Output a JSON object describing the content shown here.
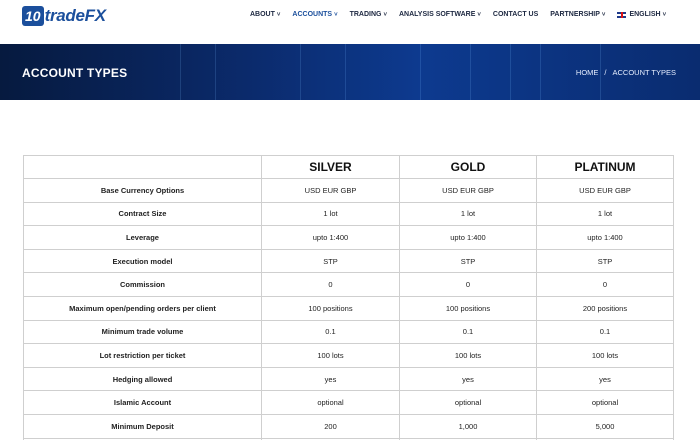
{
  "header": {
    "logo_badge": "10",
    "logo_text": "tradeFX",
    "nav": [
      {
        "label": "ABOUT",
        "chevron": true,
        "active": false
      },
      {
        "label": "ACCOUNTS",
        "chevron": true,
        "active": true
      },
      {
        "label": "TRADING",
        "chevron": true,
        "active": false
      },
      {
        "label": "ANALYSIS SOFTWARE",
        "chevron": true,
        "active": false
      },
      {
        "label": "CONTACT US",
        "chevron": false,
        "active": false
      },
      {
        "label": "PARTNERSHIP",
        "chevron": true,
        "active": false
      },
      {
        "label": "ENGLISH",
        "chevron": true,
        "active": false,
        "flag": "uk-flag-icon"
      }
    ]
  },
  "banner": {
    "title": "ACCOUNT TYPES",
    "breadcrumb": [
      "HOME",
      "/",
      "ACCOUNT TYPES"
    ]
  },
  "table": {
    "columns": [
      "",
      "SILVER",
      "GOLD",
      "PLATINUM"
    ],
    "rows": [
      {
        "label": "Base Currency Options",
        "values": [
          "USD EUR GBP",
          "USD EUR GBP",
          "USD EUR GBP"
        ]
      },
      {
        "label": "Contract Size",
        "values": [
          "1 lot",
          "1 lot",
          "1 lot"
        ]
      },
      {
        "label": "Leverage",
        "values": [
          "upto 1:400",
          "upto 1:400",
          "upto 1:400"
        ]
      },
      {
        "label": "Execution model",
        "values": [
          "STP",
          "STP",
          "STP"
        ]
      },
      {
        "label": "Commission",
        "values": [
          "0",
          "0",
          "0"
        ]
      },
      {
        "label": "Maximum open/pending orders per client",
        "values": [
          "100 positions",
          "100 positions",
          "200 positions"
        ]
      },
      {
        "label": "Minimum trade volume",
        "values": [
          "0.1",
          "0.1",
          "0.1"
        ]
      },
      {
        "label": "Lot restriction per ticket",
        "values": [
          "100 lots",
          "100 lots",
          "100 lots"
        ]
      },
      {
        "label": "Hedging allowed",
        "values": [
          "yes",
          "yes",
          "yes"
        ]
      },
      {
        "label": "Islamic Account",
        "values": [
          "optional",
          "optional",
          "optional"
        ]
      },
      {
        "label": "Minimum Deposit",
        "values": [
          "200",
          "1,000",
          "5,000"
        ]
      }
    ]
  },
  "colors": {
    "brand": "#1b4f9c",
    "nav_text": "#1c2740",
    "banner_dark": "#061a3f",
    "banner_mid": "#0d3a8f"
  }
}
